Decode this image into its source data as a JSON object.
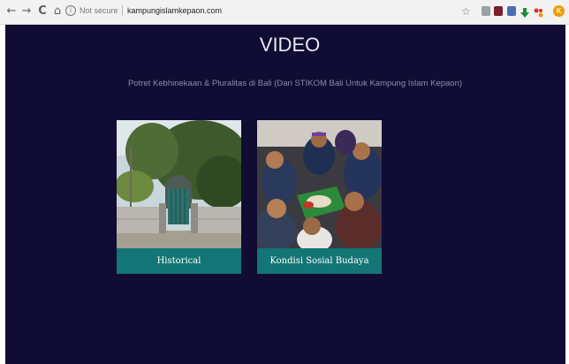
{
  "browser": {
    "back_icon": "←",
    "forward_icon": "→",
    "reload_icon": "C",
    "home_icon": "⌂",
    "info_icon": "i",
    "security_label": "Not secure",
    "url": "kampungislamkepaon.com",
    "profile_initial": "K"
  },
  "page": {
    "title": "VIDEO",
    "subtitle": "Potret Kebhinekaan & Pluralitas di Bali (Dari STIKOM Bali Untuk Kampung Islam Kepaon)"
  },
  "cards": [
    {
      "label": "Historical"
    },
    {
      "label": "Kondisi Sosial Budaya"
    }
  ],
  "colors": {
    "page_bg": "#100c33",
    "card_label_bg": "#137575"
  }
}
